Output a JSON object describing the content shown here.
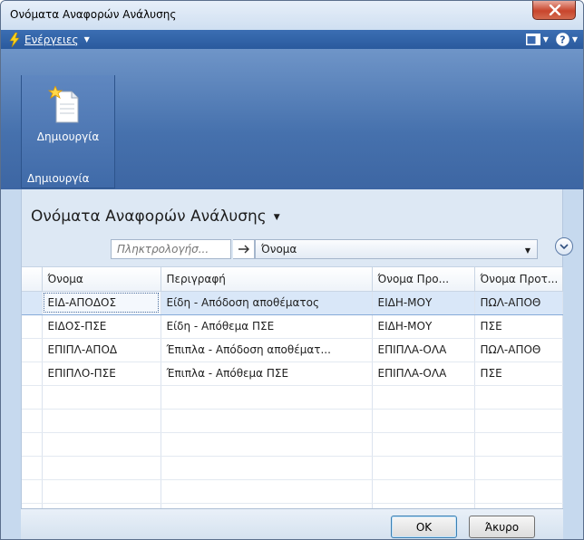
{
  "window": {
    "title": "Ονόματα Αναφορών Ανάλυσης"
  },
  "actionbar": {
    "actions_label": "Ενέργειες"
  },
  "ribbon": {
    "create_button_label": "Δημιουργία",
    "group_label": "Δημιουργία"
  },
  "page": {
    "title": "Ονόματα Αναφορών Ανάλυσης"
  },
  "filter": {
    "search_placeholder": "Πληκτρολογήσ...",
    "field_value": "Όνομα"
  },
  "grid": {
    "columns": [
      "Όνομα",
      "Περιγραφή",
      "Όνομα Προ...",
      "Όνομα Προτ..."
    ],
    "rows": [
      [
        "ΕΙΔ-ΑΠΟΔΟΣ",
        "Είδη - Απόδοση αποθέματος",
        "ΕΙΔΗ-ΜΟΥ",
        "ΠΩΛ-ΑΠΟΘ"
      ],
      [
        "ΕΙΔΟΣ-ΠΣΕ",
        "Είδη - Απόθεμα ΠΣΕ",
        "ΕΙΔΗ-ΜΟΥ",
        "ΠΣΕ"
      ],
      [
        "ΕΠΙΠΛ-ΑΠΟΔ",
        "Έπιπλα - Απόδοση αποθέματ...",
        "ΕΠΙΠΛΑ-ΟΛΑ",
        "ΠΩΛ-ΑΠΟΘ"
      ],
      [
        "ΕΠΙΠΛΟ-ΠΣΕ",
        "Έπιπλα - Απόθεμα ΠΣΕ",
        "ΕΠΙΠΛΑ-ΟΛΑ",
        "ΠΣΕ"
      ]
    ]
  },
  "footer": {
    "ok_label": "OK",
    "cancel_label": "Άκυρο"
  },
  "colors": {
    "ribbon": "#4671ad",
    "actionbar": "#2a5a9d",
    "content": "#dde8f4",
    "selected_row": "#d9e7f8"
  }
}
